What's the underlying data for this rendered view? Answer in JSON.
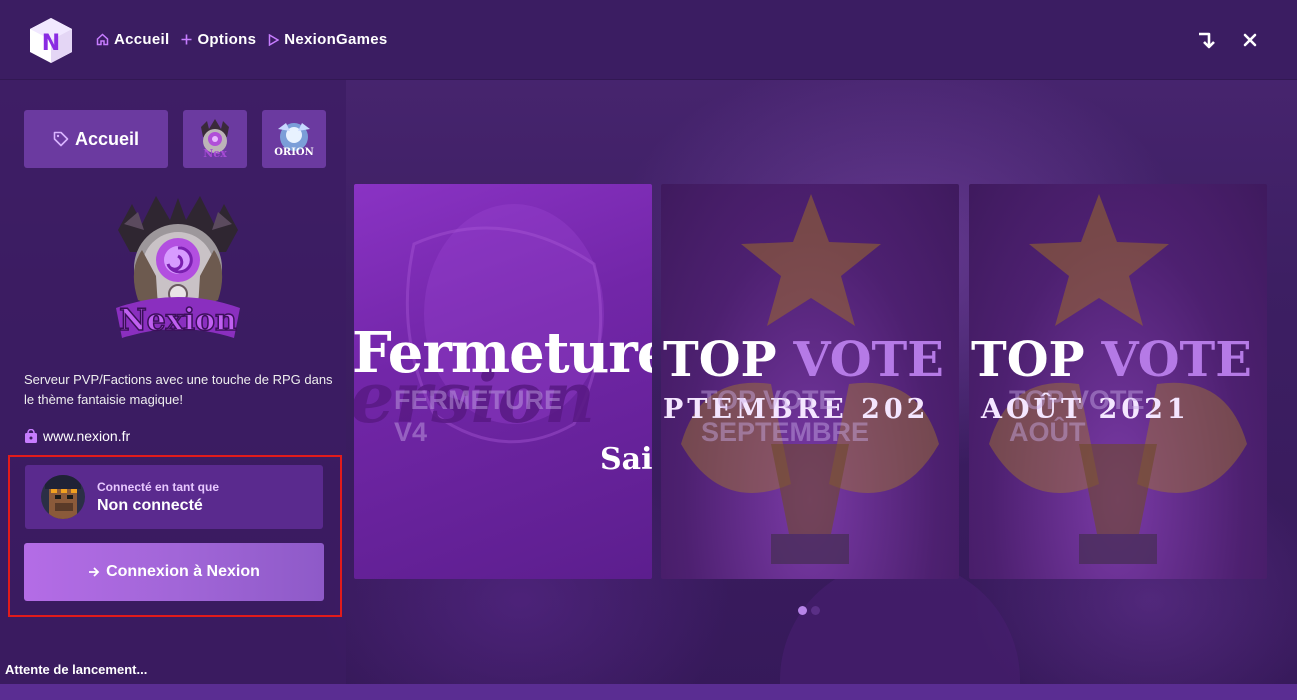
{
  "window": {
    "nav": [
      {
        "label": "Accueil",
        "icon": "home-icon"
      },
      {
        "label": "Options",
        "icon": "plus-icon"
      },
      {
        "label": "NexionGames",
        "icon": "play-icon"
      }
    ],
    "controls": {
      "minimize_icon": "arrow-down-turn-icon",
      "close_icon": "close-icon"
    }
  },
  "sidebar": {
    "home_tab": {
      "label": "Accueil",
      "icon": "tag-icon"
    },
    "server_tabs": [
      "nexion-server-icon",
      "orion-server-icon"
    ],
    "description": "Serveur PVP/Factions avec une touche de RPG dans le thème fantaisie magique!",
    "website": "www.nexion.fr",
    "user_card": {
      "caption": "Connecté en tant que",
      "name": "Non connecté"
    },
    "connect_button": {
      "label": "Connexion à Nexion",
      "icon": "arrow-right-icon"
    }
  },
  "news_cards": [
    {
      "title_art": "Fermeture",
      "art_shadow": "ersion",
      "art_suffix": "Sai",
      "overlay": [
        "FERMETURE",
        "V4"
      ]
    },
    {
      "title_art_prefix": "TOP",
      "title_art_accent": "VOTE",
      "month_art": "PTEMBRE 202",
      "overlay": [
        "TOP VOTE",
        "SEPTEMBRE"
      ]
    },
    {
      "title_art_prefix": "TOP",
      "title_art_accent": "VOTE",
      "month_art": "AOÛT 2021",
      "overlay": [
        "TOP VOTE",
        "AOÛT"
      ]
    }
  ],
  "carousel": {
    "pages": 2,
    "active": 1
  },
  "status": {
    "text": "Attente de lancement...",
    "progress": 0.0
  },
  "colors": {
    "accent": "#c77dff",
    "highlight": "#e21b1b"
  }
}
